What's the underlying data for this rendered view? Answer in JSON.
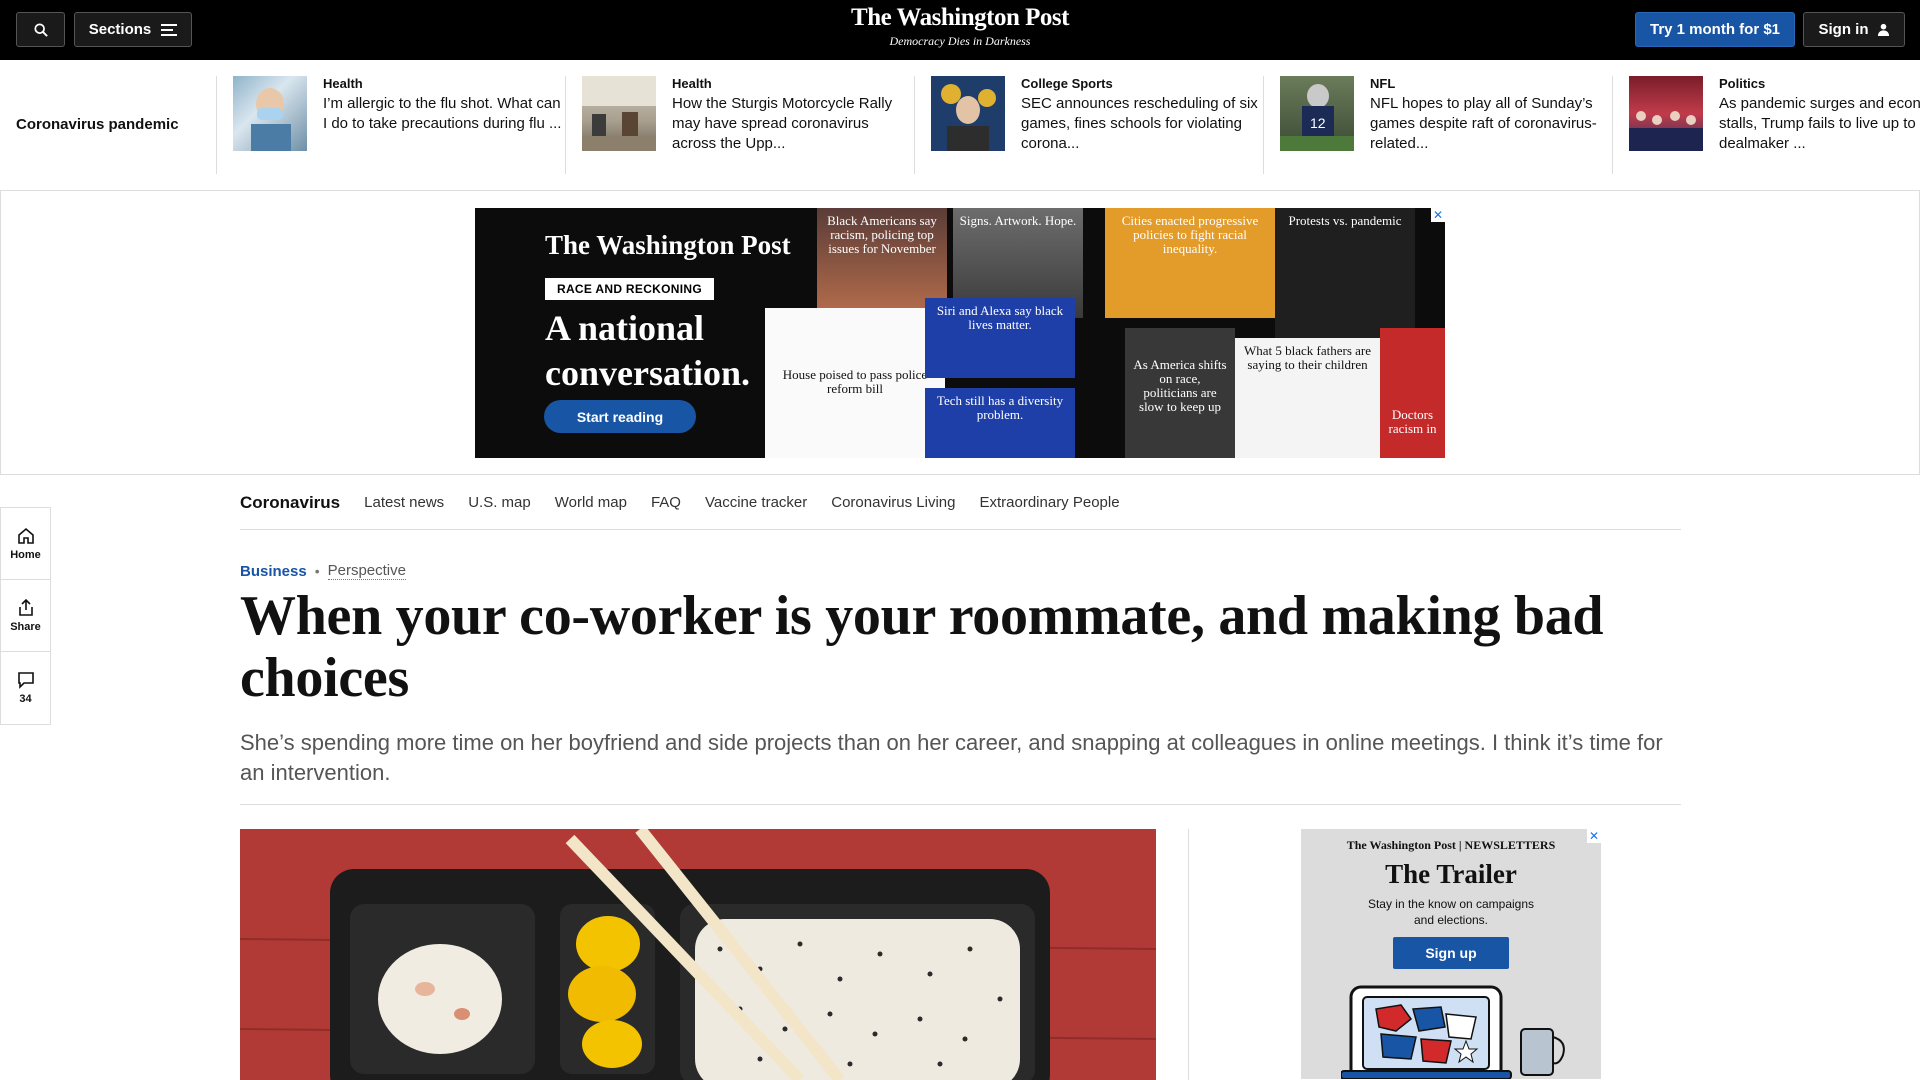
{
  "topbar": {
    "sections_label": "Sections",
    "logo_name": "The Washington Post",
    "logo_tagline": "Democracy Dies in Darkness",
    "try_label": "Try 1 month for $1",
    "signin_label": "Sign in"
  },
  "strip": {
    "title": "Coronavirus pandemic",
    "items": [
      {
        "category": "Health",
        "headline": "I’m allergic to the flu shot. What can I do to take precautions during flu ..."
      },
      {
        "category": "Health",
        "headline": "How the Sturgis Motorcycle Rally may have spread coronavirus across the Upp..."
      },
      {
        "category": "College Sports",
        "headline": "SEC announces rescheduling of six games, fines schools for violating corona..."
      },
      {
        "category": "NFL",
        "headline": "NFL hopes to play all of Sunday’s games despite raft of coronavirus-related..."
      },
      {
        "category": "Politics",
        "headline": "As pandemic surges and economy stalls, Trump fails to live up to dealmaker ..."
      }
    ]
  },
  "ad": {
    "logo": "The Washington Post",
    "badge": "RACE AND RECKONING",
    "headline": "A national conversation.",
    "cta": "Start reading",
    "tiles": [
      "Black Americans say racism, policing top issues for November",
      "Signs. Artwork. Hope.",
      "Cities enacted progressive policies to fight racial inequality.",
      "Protests vs. pandemic",
      "House poised to pass police reform bill",
      "Siri and Alexa say black lives matter.",
      "Tech still has a diversity problem.",
      "As America shifts on race, politicians are slow to keep up",
      "What 5 black fathers are saying to their children",
      "Doctors racism in"
    ],
    "close": "✕"
  },
  "subnav": {
    "brand": "Coronavirus",
    "links": [
      "Latest news",
      "U.S. map",
      "World map",
      "FAQ",
      "Vaccine tracker",
      "Coronavirus Living",
      "Extraordinary People"
    ]
  },
  "rail": {
    "home": "Home",
    "share": "Share",
    "comments_count": "34"
  },
  "article": {
    "section": "Business",
    "separator": "•",
    "label": "Perspective",
    "headline": "When your co-worker is your roommate, and making bad choices",
    "dek": "She’s spending more time on her boyfriend and side projects than on her career, and snapping at colleagues in online meetings. I think it’s time for an intervention."
  },
  "newsletter_ad": {
    "logo": "The Washington Post | NEWSLETTERS",
    "title": "The Trailer",
    "desc": "Stay in the know on campaigns and elections.",
    "cta": "Sign up",
    "close": "✕"
  },
  "colors": {
    "accent": "#1955a5",
    "topbar": "#000000",
    "photo_bg": "#b23a36"
  }
}
